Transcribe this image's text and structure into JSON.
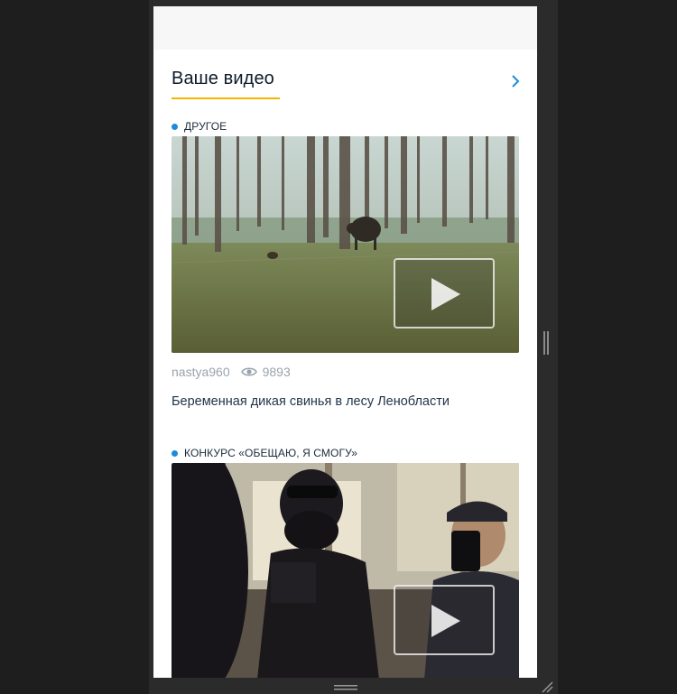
{
  "section": {
    "title": "Ваше видео",
    "more_icon": "chevron-right-icon",
    "accent_color": "#f4b400",
    "link_color": "#1c8cd8"
  },
  "videos": [
    {
      "category": "ДРУГОЕ",
      "author": "nastya960",
      "views": "9893",
      "title": "Беременная дикая свинья в лесу Ленобласти",
      "thumbnail": "forest-boar-thumbnail"
    },
    {
      "category": "КОНКУРС «ОБЕЩАЮ, Я СМОГУ»",
      "thumbnail": "masked-people-selfie-thumbnail"
    }
  ]
}
